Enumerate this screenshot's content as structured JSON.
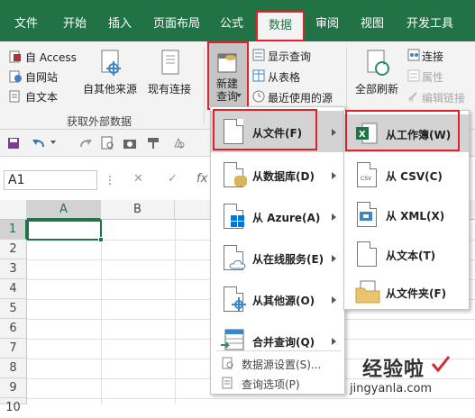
{
  "tabs": [
    "文件",
    "开始",
    "插入",
    "页面布局",
    "公式",
    "数据",
    "审阅",
    "视图",
    "开发工具"
  ],
  "active_tab": "数据",
  "ribbon": {
    "access": "自 Access",
    "web": "自网站",
    "text": "自文本",
    "other_sources": "自其他来源",
    "existing_connections": "现有连接",
    "group_external": "获取外部数据",
    "new_query_line1": "新建",
    "new_query_line2": "查询",
    "show_queries": "显示查询",
    "from_table": "从表格",
    "recent_sources": "最近使用的源",
    "refresh_all": "全部刷新",
    "connections": "连接",
    "properties": "属性",
    "edit_links": "编辑链接"
  },
  "namebox": "A1",
  "formula_fx": "fx",
  "columns": [
    "A",
    "B"
  ],
  "rows": [
    "1",
    "2",
    "3",
    "4",
    "5",
    "6",
    "7",
    "8",
    "9",
    "10"
  ],
  "menu_main": {
    "items": [
      {
        "label": "从文件(F)",
        "has_arrow": true
      },
      {
        "label": "从数据库(D)",
        "has_arrow": true
      },
      {
        "label": "从 Azure(A)",
        "has_arrow": true
      },
      {
        "label": "从在线服务(E)",
        "has_arrow": true
      },
      {
        "label": "从其他源(O)",
        "has_arrow": true
      },
      {
        "label": "合并查询(Q)",
        "has_arrow": true
      }
    ],
    "settings": "数据源设置(S)...",
    "options": "查询选项(P)"
  },
  "menu_sub": {
    "items": [
      "从工作簿(W)",
      "从 CSV(C)",
      "从 XML(X)",
      "从文本(T)",
      "从文件夹(F)"
    ]
  },
  "watermark": {
    "line1": "经验啦",
    "line2": "jingyanla.com"
  },
  "colors": {
    "accent": "#217346",
    "highlight_border": "#e2202a"
  }
}
